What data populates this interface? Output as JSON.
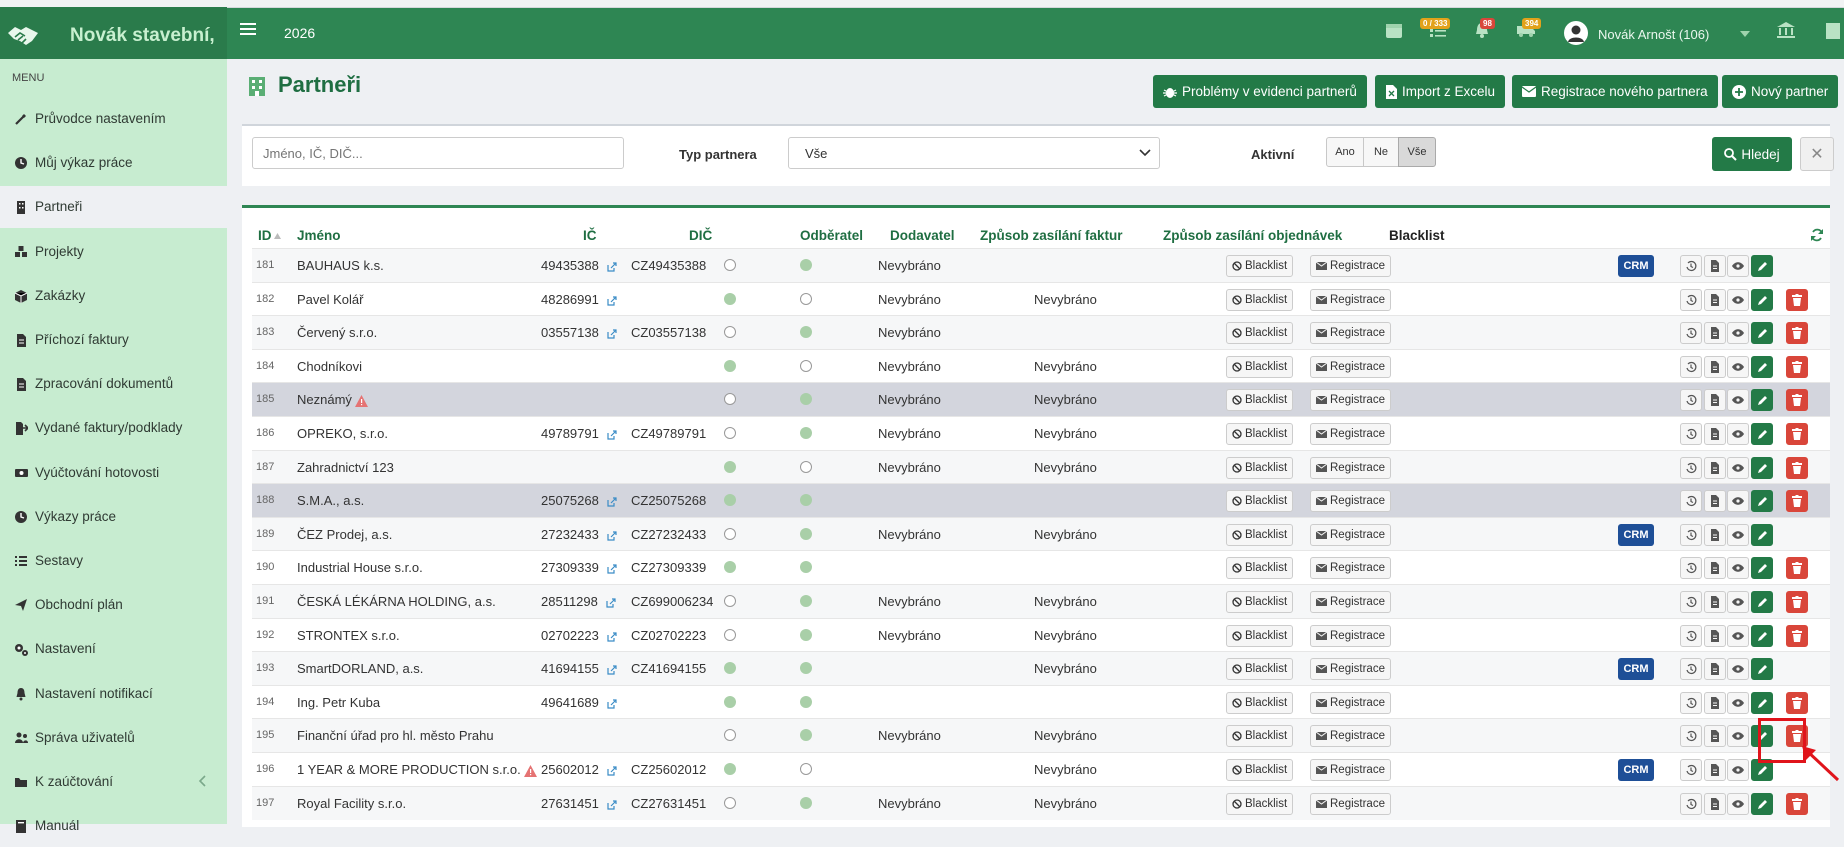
{
  "app": {
    "brand_name": "Novák stavební,",
    "year": "2026"
  },
  "topbar": {
    "badge_tasks": "0 / 333",
    "badge_notifications": "98",
    "badge_delivery": "394",
    "badge_colors": {
      "tasks": "#e2a21b",
      "notifications": "#d9463a",
      "delivery": "#e2a21b"
    },
    "user_name": "Novák Arnošt (106)"
  },
  "sidebar": {
    "menu_label": "MENU",
    "items": [
      {
        "label": "Průvodce nastavením",
        "icon": "wand-icon"
      },
      {
        "label": "Můj výkaz práce",
        "icon": "clock-icon"
      },
      {
        "label": "Partneři",
        "icon": "building-icon",
        "active": true
      },
      {
        "label": "Projekty",
        "icon": "cubes-icon"
      },
      {
        "label": "Zakázky",
        "icon": "box-icon"
      },
      {
        "label": "Příchozí faktury",
        "icon": "document-icon"
      },
      {
        "label": "Zpracování dokumentů",
        "icon": "document-icon"
      },
      {
        "label": "Vydané faktury/podklady",
        "icon": "export-file-icon"
      },
      {
        "label": "Vyúčtování hotovosti",
        "icon": "cash-icon"
      },
      {
        "label": "Výkazy práce",
        "icon": "clock-icon"
      },
      {
        "label": "Sestavy",
        "icon": "list-icon"
      },
      {
        "label": "Obchodní plán",
        "icon": "paper-plane-icon"
      },
      {
        "label": "Nastavení",
        "icon": "gears-icon"
      },
      {
        "label": "Nastavení notifikací",
        "icon": "bell-icon"
      },
      {
        "label": "Správa uživatelů",
        "icon": "users-icon"
      },
      {
        "label": "K zaúčtování",
        "icon": "folder-icon"
      },
      {
        "label": "Manuál",
        "icon": "book-icon"
      }
    ]
  },
  "page": {
    "title": "Partneři"
  },
  "toolbar": {
    "problems": "Problémy v evidenci partnerů",
    "import": "Import z Excelu",
    "register": "Registrace nového partnera",
    "new": "Nový partner"
  },
  "filter": {
    "search_placeholder": "Jméno, IČ, DIČ...",
    "type_label": "Typ partnera",
    "type_value": "Vše",
    "active_label": "Aktivní",
    "active_options": [
      "Ano",
      "Ne",
      "Vše"
    ],
    "active_selected": "Vše",
    "search_button": "Hledej",
    "clear_button": "✕"
  },
  "table": {
    "columns": [
      "ID",
      "Jméno",
      "IČ",
      "DIČ",
      "Odběratel",
      "Dodavatel",
      "Způsob zasílání faktur",
      "Způsob zasílání objednávek",
      "Blacklist"
    ],
    "blacklist_btn": "Blacklist",
    "registrace_btn": "Registrace",
    "crm_label": "CRM",
    "rows": [
      {
        "id": "181",
        "name": "BAUHAUS k.s.",
        "ic": "49435388",
        "dic": "CZ49435388",
        "odberatel": false,
        "dodavatel": true,
        "faktury": "Nevybráno",
        "objednavky": "",
        "crm": true,
        "delete": false,
        "warn": false,
        "highlight": false
      },
      {
        "id": "182",
        "name": "Pavel Kolář",
        "ic": "48286991",
        "dic": "",
        "odberatel": true,
        "dodavatel": false,
        "faktury": "Nevybráno",
        "objednavky": "Nevybráno",
        "crm": false,
        "delete": true,
        "warn": false,
        "highlight": false
      },
      {
        "id": "183",
        "name": "Červený s.r.o.",
        "ic": "03557138",
        "dic": "CZ03557138",
        "odberatel": false,
        "dodavatel": true,
        "faktury": "Nevybráno",
        "objednavky": "",
        "crm": false,
        "delete": true,
        "warn": false,
        "highlight": false
      },
      {
        "id": "184",
        "name": "Chodníkovi",
        "ic": "",
        "dic": "",
        "odberatel": true,
        "dodavatel": false,
        "faktury": "Nevybráno",
        "objednavky": "Nevybráno",
        "crm": false,
        "delete": true,
        "warn": false,
        "highlight": false
      },
      {
        "id": "185",
        "name": "Neznámý",
        "ic": "",
        "dic": "",
        "odberatel": false,
        "dodavatel": true,
        "faktury": "Nevybráno",
        "objednavky": "Nevybráno",
        "crm": false,
        "delete": true,
        "warn": true,
        "highlight": true
      },
      {
        "id": "186",
        "name": "OPREKO, s.r.o.",
        "ic": "49789791",
        "dic": "CZ49789791",
        "odberatel": false,
        "dodavatel": true,
        "faktury": "Nevybráno",
        "objednavky": "Nevybráno",
        "crm": false,
        "delete": true,
        "warn": false,
        "highlight": false
      },
      {
        "id": "187",
        "name": "Zahradnictví 123",
        "ic": "",
        "dic": "",
        "odberatel": true,
        "dodavatel": false,
        "faktury": "Nevybráno",
        "objednavky": "Nevybráno",
        "crm": false,
        "delete": true,
        "warn": false,
        "highlight": false
      },
      {
        "id": "188",
        "name": "S.M.A., a.s.",
        "ic": "25075268",
        "dic": "CZ25075268",
        "odberatel": true,
        "dodavatel": true,
        "faktury": "",
        "objednavky": "",
        "crm": false,
        "delete": true,
        "warn": false,
        "highlight": true
      },
      {
        "id": "189",
        "name": "ČEZ Prodej, a.s.",
        "ic": "27232433",
        "dic": "CZ27232433",
        "odberatel": false,
        "dodavatel": true,
        "faktury": "Nevybráno",
        "objednavky": "Nevybráno",
        "crm": true,
        "delete": false,
        "warn": false,
        "highlight": false
      },
      {
        "id": "190",
        "name": "Industrial House s.r.o.",
        "ic": "27309339",
        "dic": "CZ27309339",
        "odberatel": true,
        "dodavatel": true,
        "faktury": "",
        "objednavky": "",
        "crm": false,
        "delete": true,
        "warn": false,
        "highlight": false
      },
      {
        "id": "191",
        "name": "ČESKÁ LÉKÁRNA HOLDING, a.s.",
        "ic": "28511298",
        "dic": "CZ699006234",
        "odberatel": false,
        "dodavatel": true,
        "faktury": "Nevybráno",
        "objednavky": "Nevybráno",
        "crm": false,
        "delete": true,
        "warn": false,
        "highlight": false
      },
      {
        "id": "192",
        "name": "STRONTEX s.r.o.",
        "ic": "02702223",
        "dic": "CZ02702223",
        "odberatel": false,
        "dodavatel": true,
        "faktury": "Nevybráno",
        "objednavky": "Nevybráno",
        "crm": false,
        "delete": true,
        "warn": false,
        "highlight": false
      },
      {
        "id": "193",
        "name": "SmartDORLAND, a.s.",
        "ic": "41694155",
        "dic": "CZ41694155",
        "odberatel": true,
        "dodavatel": true,
        "faktury": "",
        "objednavky": "Nevybráno",
        "crm": true,
        "delete": false,
        "warn": false,
        "highlight": false
      },
      {
        "id": "194",
        "name": "Ing. Petr Kuba",
        "ic": "49641689",
        "dic": "",
        "odberatel": true,
        "dodavatel": true,
        "faktury": "",
        "objednavky": "",
        "crm": false,
        "delete": true,
        "warn": false,
        "highlight": false
      },
      {
        "id": "195",
        "name": "Finanční úřad pro hl. město Prahu",
        "ic": "",
        "dic": "",
        "odberatel": false,
        "dodavatel": true,
        "faktury": "Nevybráno",
        "objednavky": "Nevybráno",
        "crm": false,
        "delete": true,
        "warn": false,
        "highlight": false
      },
      {
        "id": "196",
        "name": "1 YEAR & MORE PRODUCTION s.r.o.",
        "ic": "25602012",
        "dic": "CZ25602012",
        "odberatel": true,
        "dodavatel": false,
        "faktury": "",
        "objednavky": "Nevybráno",
        "crm": true,
        "delete": false,
        "warn": true,
        "highlight": false
      },
      {
        "id": "197",
        "name": "Royal Facility s.r.o.",
        "ic": "27631451",
        "dic": "CZ27631451",
        "odberatel": false,
        "dodavatel": true,
        "faktury": "Nevybráno",
        "objednavky": "Nevybráno",
        "crm": false,
        "delete": true,
        "warn": false,
        "highlight": false
      }
    ]
  }
}
